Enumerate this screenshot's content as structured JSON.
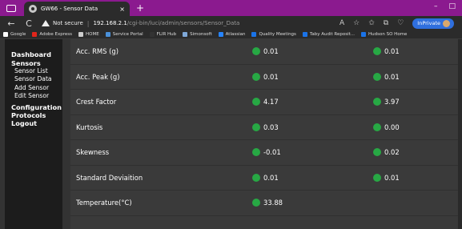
{
  "browser": {
    "tab_title": "GW66 - Sensor Data",
    "tab_close": "×",
    "tab_new": "+",
    "win_min": "–",
    "win_max": "□",
    "nav_back": "←",
    "nav_reload": "C",
    "not_secure": "Not secure",
    "url_host": "192.168.2.1",
    "url_path": "/cgi-bin/luci/admin/sensors/Sensor_Data",
    "inprivate": "InPrivate"
  },
  "bookmarks": [
    {
      "label": "Google",
      "color": "#ffffff"
    },
    {
      "label": "Adobe Express",
      "color": "#e1251b"
    },
    {
      "label": "HOME",
      "color": "#cccccc"
    },
    {
      "label": "Service Portal",
      "color": "#4a90d9"
    },
    {
      "label": "FLIR Hub",
      "color": "#333333"
    },
    {
      "label": "Simonsoft",
      "color": "#7fa8d8"
    },
    {
      "label": "Atlassian",
      "color": "#2684ff"
    },
    {
      "label": "Quality Meetings",
      "color": "#1a73e8"
    },
    {
      "label": "Taby Audit Reposit...",
      "color": "#1a73e8"
    },
    {
      "label": "Hudson SO Home",
      "color": "#1a73e8"
    }
  ],
  "sidebar": {
    "dashboard": "Dashboard",
    "sensors": "Sensors",
    "sensor_list": "Sensor List",
    "sensor_data": "Sensor Data",
    "add_sensor": "Add Sensor",
    "edit_sensor": "Edit Sensor",
    "configuration": "Configuration",
    "protocols": "Protocols",
    "logout": "Logout"
  },
  "rows": [
    {
      "label": "Acc. RMS (g)",
      "v1": "0.01",
      "v2": "0.01"
    },
    {
      "label": "Acc. Peak (g)",
      "v1": "0.01",
      "v2": "0.01"
    },
    {
      "label": "Crest Factor",
      "v1": "4.17",
      "v2": "3.97"
    },
    {
      "label": "Kurtosis",
      "v1": "0.03",
      "v2": "0.00"
    },
    {
      "label": "Skewness",
      "v1": "-0.01",
      "v2": "0.02"
    },
    {
      "label": "Standard Deviaition",
      "v1": "0.01",
      "v2": "0.01"
    },
    {
      "label": "Temperature(°C)",
      "v1": "33.88",
      "v2": ""
    }
  ],
  "colors": {
    "status_ok": "#27a844",
    "titlebar": "#8b1a8f",
    "accent_inprivate": "#2f6fde"
  }
}
